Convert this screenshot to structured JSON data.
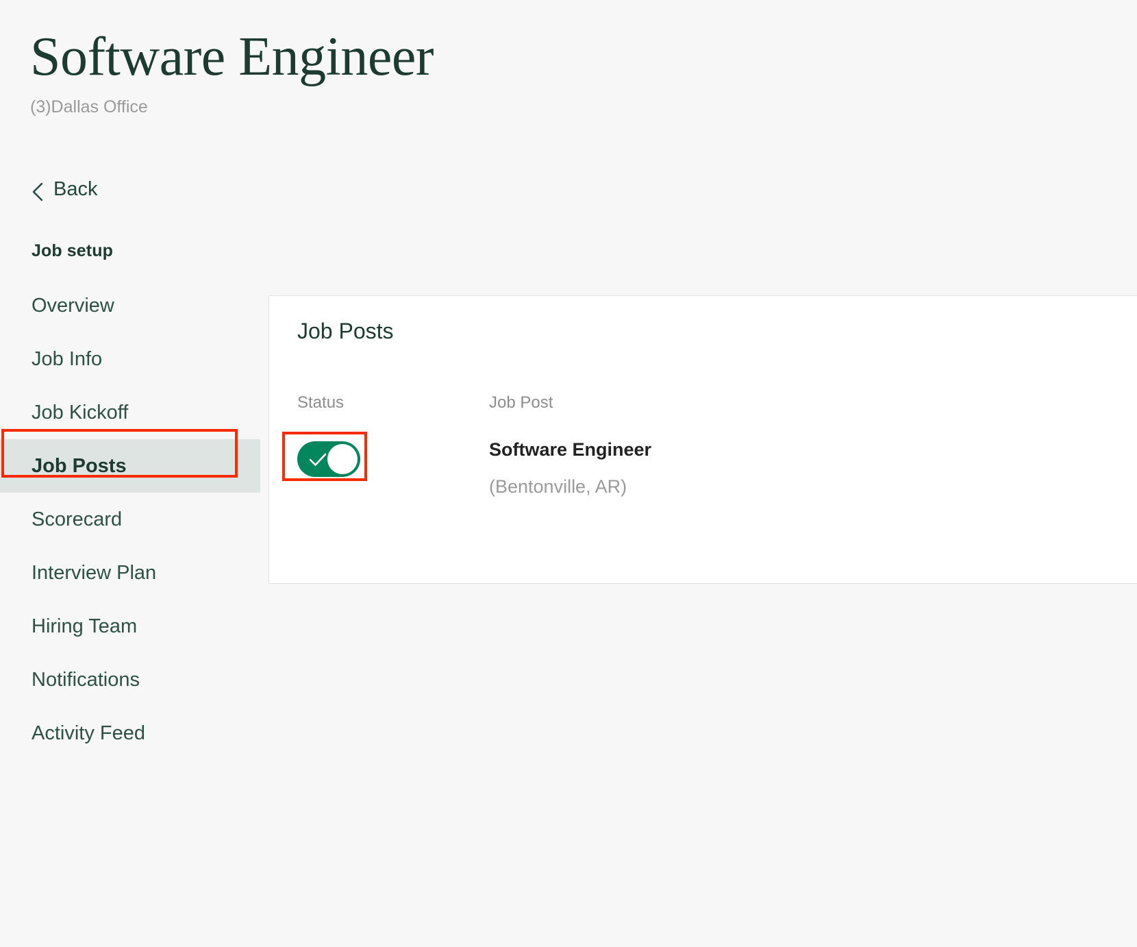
{
  "header": {
    "title": "Software Engineer",
    "subtitle": "(3)Dallas Office"
  },
  "sidebar": {
    "back_label": "Back",
    "back_icon": "chevron-left-icon",
    "section_title": "Job setup",
    "items": [
      {
        "label": "Overview",
        "active": false
      },
      {
        "label": "Job Info",
        "active": false
      },
      {
        "label": "Job Kickoff",
        "active": false
      },
      {
        "label": "Job Posts",
        "active": true
      },
      {
        "label": "Scorecard",
        "active": false
      },
      {
        "label": "Interview Plan",
        "active": false
      },
      {
        "label": "Hiring Team",
        "active": false
      },
      {
        "label": "Notifications",
        "active": false
      },
      {
        "label": "Activity Feed",
        "active": false
      }
    ]
  },
  "card": {
    "title": "Job Posts",
    "columns": {
      "status": "Status",
      "job_post": "Job Post"
    },
    "rows": [
      {
        "status_on": true,
        "toggle_icon": "check-icon",
        "name": "Software Engineer",
        "location": "(Bentonville, AR)"
      }
    ]
  },
  "colors": {
    "brand_green": "#1d3b31",
    "nav_green": "#2e5145",
    "active_bg": "#dde4e1",
    "toggle_on": "#03865b",
    "annotation_red": "#f72c04",
    "page_bg": "#f7f7f7",
    "muted_text": "#9a9a9a"
  }
}
